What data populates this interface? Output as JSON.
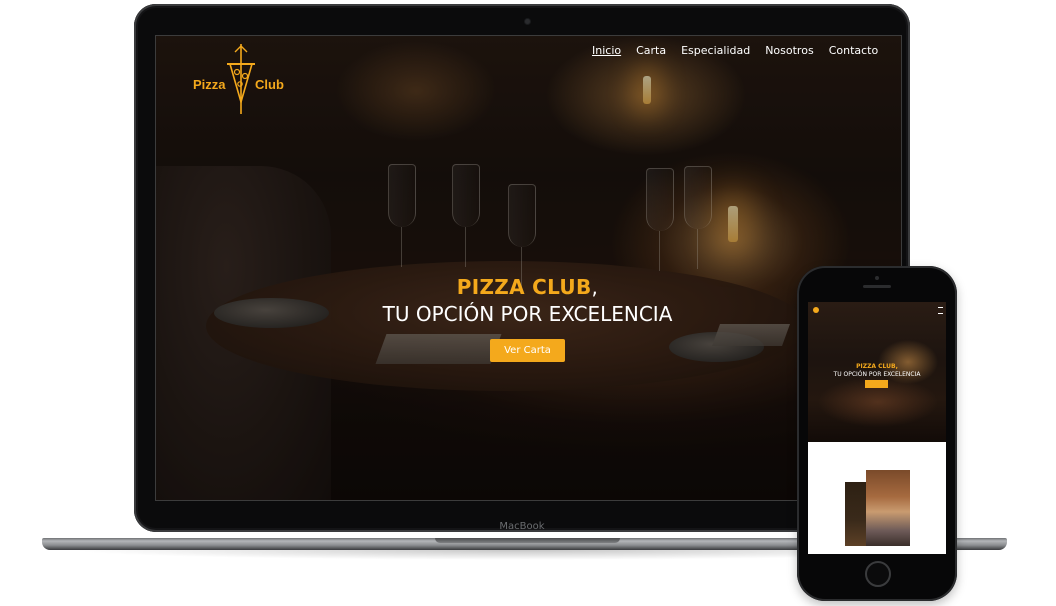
{
  "laptop": {
    "brand_label": "MacBook",
    "site": {
      "logo": {
        "left_word": "Pizza",
        "right_word": "Club"
      },
      "nav": [
        {
          "label": "Inicio",
          "active": true
        },
        {
          "label": "Carta",
          "active": false
        },
        {
          "label": "Especialidad",
          "active": false
        },
        {
          "label": "Nosotros",
          "active": false
        },
        {
          "label": "Contacto",
          "active": false
        }
      ],
      "hero": {
        "title": "PIZZA CLUB",
        "title_suffix": ",",
        "subtitle": "TU OPCIÓN POR EXCELENCIA",
        "cta_label": "Ver Carta"
      }
    }
  },
  "phone": {
    "site": {
      "hero": {
        "title": "PIZZA CLUB,",
        "subtitle": "TU OPCIÓN POR EXCELENCIA"
      }
    }
  },
  "colors": {
    "accent": "#f4a91c",
    "device_frame": "#0b0b0c",
    "text_light": "#ffffff"
  },
  "icons": {
    "logo_mark": "pizza-slice-knife-icon",
    "phone_menu": "hamburger-menu-icon",
    "phone_home": "home-button-icon"
  }
}
